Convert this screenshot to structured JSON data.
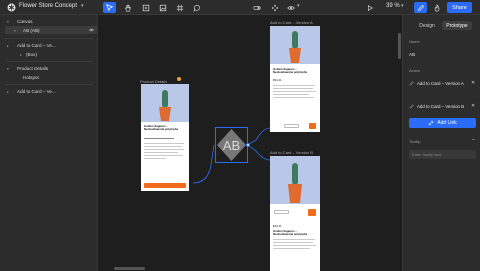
{
  "topbar": {
    "project_name": "Flower Store Concept",
    "zoom": "39 %",
    "share_label": "Share"
  },
  "layers": {
    "canvas": "Canvas",
    "ab": "AB (AB)",
    "add_to_card_1": "Add to Card – Ve...",
    "box": "(Box)",
    "product_details": "Product Details",
    "hotspot": "Hotspot",
    "add_to_card_2": "Add to Card – Ve..."
  },
  "canvas": {
    "product_details_label": "Product Details",
    "version_a_label": "Add to Card – Version A",
    "version_b_label": "Add to Card – Version B",
    "ab_node_label": "AB",
    "product": {
      "title": "Golden Saguaro – Neobuxbaumia polylopha",
      "price": "€34.21"
    }
  },
  "panel": {
    "tab_design": "Design",
    "tab_prototype": "Prototype",
    "name_label": "Name",
    "name_value": "AB",
    "action_label": "Action",
    "action_a": "Add to Card – Version A",
    "action_b": "Add to Card – Version B",
    "add_link": "Add Link",
    "tooltip_label": "Tooltip",
    "tooltip_placeholder": "Enter tooltip text"
  },
  "colors": {
    "accent": "#2b6cf6",
    "orange": "#f26b1d",
    "image_bg": "#b9c7e8"
  }
}
